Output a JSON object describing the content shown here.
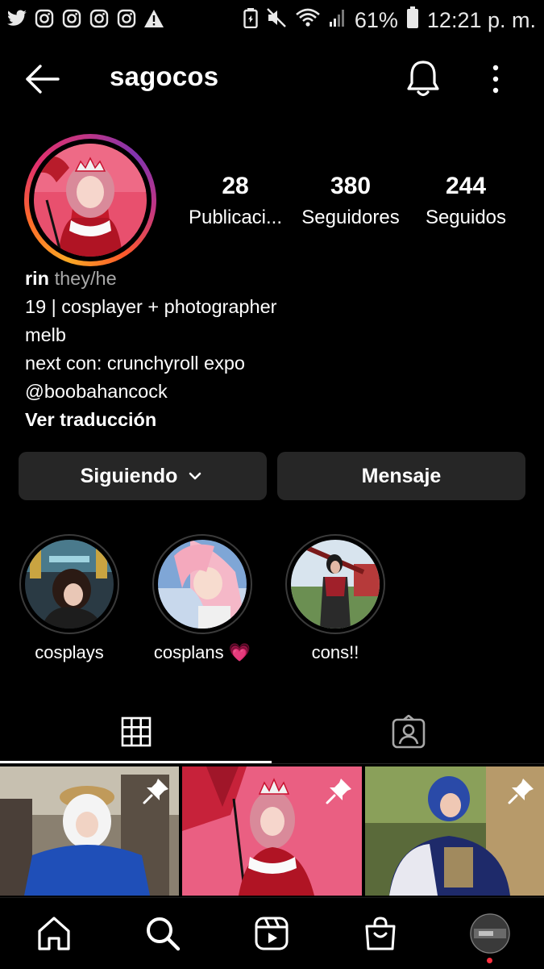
{
  "status_bar": {
    "battery_percent": "61%",
    "time": "12:21 p. m.",
    "left_icons": [
      "twitter-icon",
      "instagram-icon",
      "instagram-icon",
      "instagram-icon",
      "instagram-icon",
      "warning-icon"
    ],
    "right_icons": [
      "battery-saver-icon",
      "mute-icon",
      "wifi-icon",
      "signal-icon",
      "battery-icon"
    ]
  },
  "header": {
    "username": "sagocos"
  },
  "profile": {
    "stats": [
      {
        "value": "28",
        "label": "Publicaci..."
      },
      {
        "value": "380",
        "label": "Seguidores"
      },
      {
        "value": "244",
        "label": "Seguidos"
      }
    ],
    "name": "rin",
    "pronouns": "they/he",
    "bio_lines": [
      "19 | cosplayer + photographer",
      "melb",
      "next con: crunchyroll expo",
      "@boobahancock"
    ],
    "translate_label": "Ver traducción"
  },
  "actions": {
    "following_label": "Siguiendo",
    "message_label": "Mensaje"
  },
  "highlights": [
    {
      "label": "cosplays"
    },
    {
      "label": "cosplans 💗"
    },
    {
      "label": "cons!!"
    }
  ],
  "tabs": {
    "active": "grid",
    "items": [
      "grid-icon",
      "tagged-icon"
    ]
  },
  "bottom_nav": {
    "items": [
      "home-icon",
      "search-icon",
      "reels-icon",
      "shop-icon",
      "profile-avatar"
    ],
    "notification_dot_color": "#ff3040"
  },
  "colors": {
    "background": "#000000",
    "button_bg": "#262626",
    "secondary_text": "#a8a8a8"
  }
}
